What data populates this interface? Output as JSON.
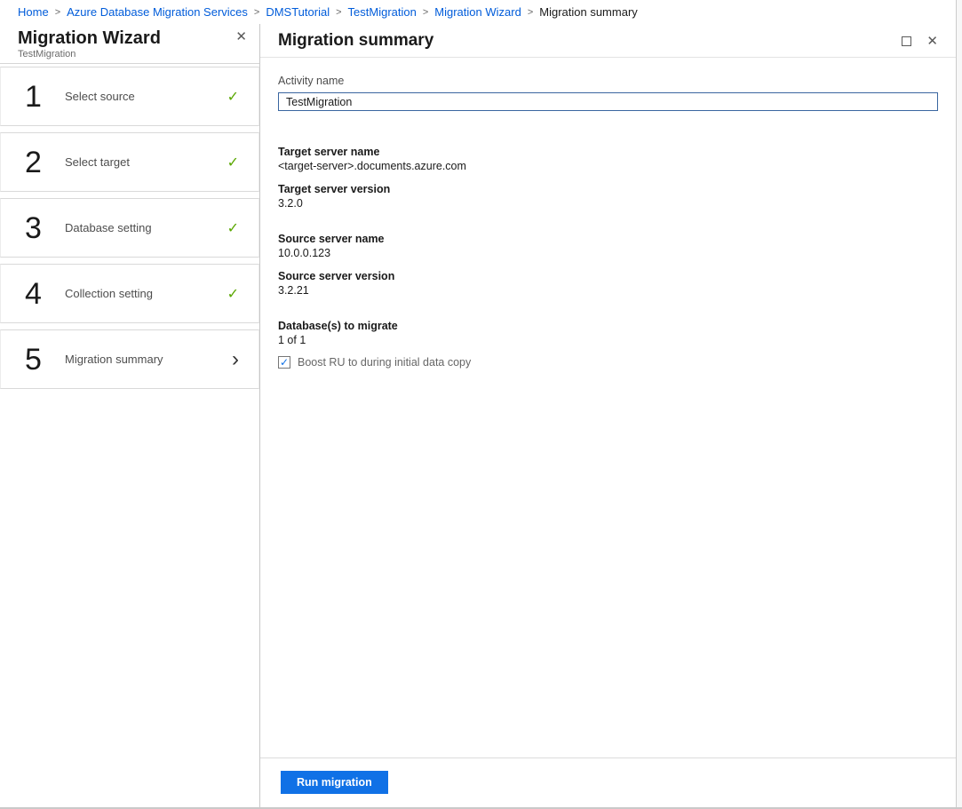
{
  "colors": {
    "link_blue": "#015cda",
    "button_blue": "#1071e6",
    "check_green": "#5aa700",
    "input_border_blue": "#3a66a0"
  },
  "icons": {
    "close": "✕",
    "check": "✓",
    "chevron_right": "›",
    "checkbox_check": "✓"
  },
  "breadcrumb": {
    "separator": ">",
    "links": [
      "Home",
      "Azure Database Migration Services",
      "DMSTutorial",
      "TestMigration",
      "Migration Wizard"
    ],
    "current": "Migration summary"
  },
  "left_panel": {
    "title": "Migration Wizard",
    "subtitle": "TestMigration",
    "steps": [
      {
        "number": "1",
        "label": "Select source",
        "status": "complete"
      },
      {
        "number": "2",
        "label": "Select target",
        "status": "complete"
      },
      {
        "number": "3",
        "label": "Database setting",
        "status": "complete"
      },
      {
        "number": "4",
        "label": "Collection setting",
        "status": "complete"
      },
      {
        "number": "5",
        "label": "Migration summary",
        "status": "current"
      }
    ]
  },
  "right_panel": {
    "title": "Migration summary",
    "activity_name": {
      "label": "Activity name",
      "value": "TestMigration"
    },
    "groups": [
      {
        "pairs": [
          {
            "label": "Target server name",
            "value": "<target-server>.documents.azure.com"
          },
          {
            "label": "Target server version",
            "value": "3.2.0"
          }
        ]
      },
      {
        "pairs": [
          {
            "label": "Source server name",
            "value": "10.0.0.123"
          },
          {
            "label": "Source server version",
            "value": "3.2.21"
          }
        ]
      },
      {
        "pairs": [
          {
            "label": "Database(s) to migrate",
            "value": "1 of 1"
          }
        ]
      }
    ],
    "checkbox": {
      "label": "Boost RU to during initial data copy",
      "checked": true
    },
    "run_button_label": "Run migration"
  }
}
